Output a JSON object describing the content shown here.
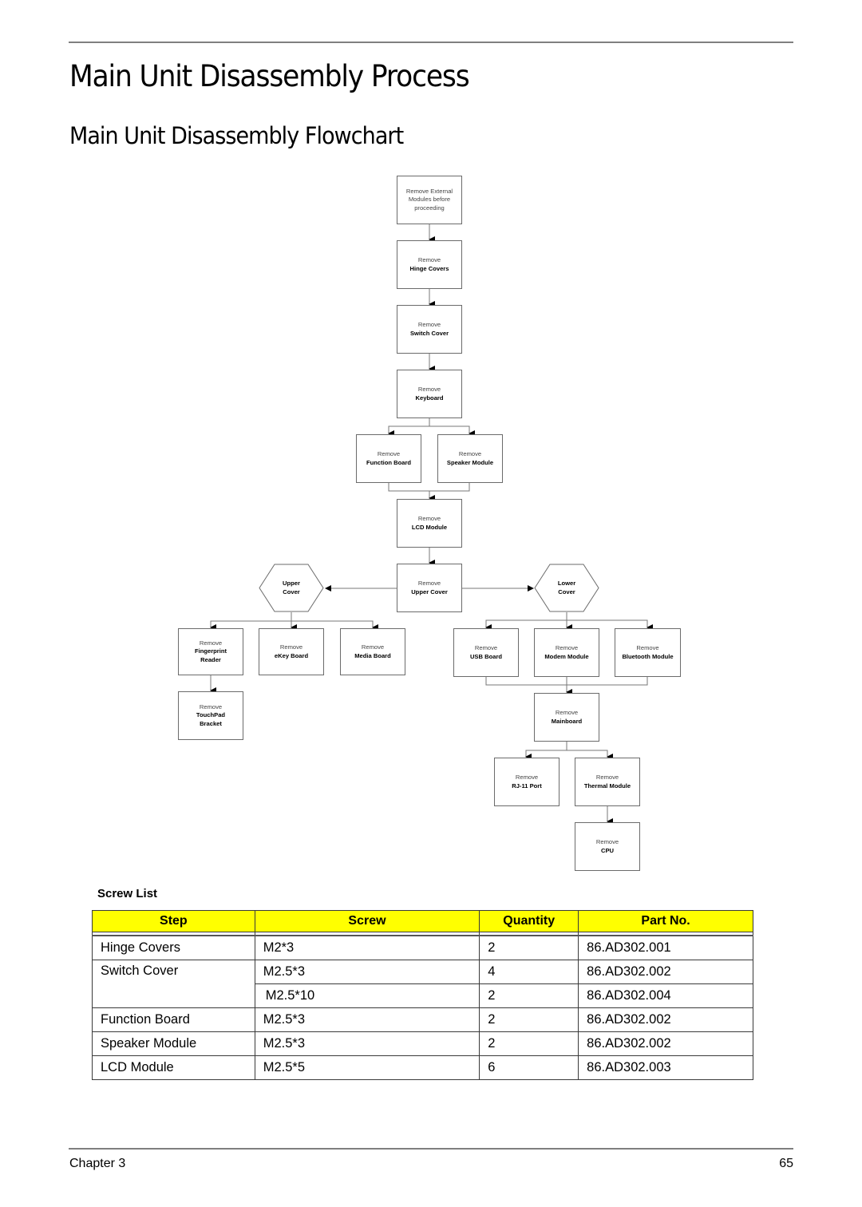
{
  "page": {
    "title": "Main Unit Disassembly Process",
    "subtitle": "Main Unit Disassembly Flowchart",
    "footer_left": "Chapter 3",
    "footer_right": "65"
  },
  "flowchart": {
    "start": {
      "l1": "Remove External",
      "l2": "Modules before",
      "l3": "proceeding"
    },
    "hinge": {
      "l1": "Remove",
      "l2": "Hinge Covers"
    },
    "switch": {
      "l1": "Remove",
      "l2": "Switch Cover"
    },
    "keyboard": {
      "l1": "Remove",
      "l2": "Keyboard"
    },
    "function": {
      "l1": "Remove",
      "l2": "Function Board"
    },
    "speaker": {
      "l1": "Remove",
      "l2": "Speaker Module"
    },
    "lcd": {
      "l1": "Remove",
      "l2": "LCD Module"
    },
    "uppercover": {
      "l1": "Remove",
      "l2": "Upper Cover"
    },
    "upper_hex": {
      "l1": "Upper",
      "l2": "Cover"
    },
    "lower_hex": {
      "l1": "Lower",
      "l2": "Cover"
    },
    "fingerprint": {
      "l1": "Remove",
      "l2": "Fingerprint",
      "l3": "Reader"
    },
    "ekey": {
      "l1": "Remove",
      "l2": "eKey Board"
    },
    "media": {
      "l1": "Remove",
      "l2": "Media Board"
    },
    "touchpad": {
      "l1": "Remove",
      "l2": "TouchPad",
      "l3": "Bracket"
    },
    "usb": {
      "l1": "Remove",
      "l2": "USB Board"
    },
    "modem": {
      "l1": "Remove",
      "l2": "Modem Module"
    },
    "bluetooth": {
      "l1": "Remove",
      "l2": "Bluetooth Module"
    },
    "mainboard": {
      "l1": "Remove",
      "l2": "Mainboard"
    },
    "rj11": {
      "l1": "Remove",
      "l2": "RJ-11 Port"
    },
    "thermal": {
      "l1": "Remove",
      "l2": "Thermal Module"
    },
    "cpu": {
      "l1": "Remove",
      "l2": "CPU"
    }
  },
  "screw_list": {
    "title": "Screw List",
    "headers": [
      "Step",
      "Screw",
      "Quantity",
      "Part No."
    ],
    "rows": [
      {
        "step": "Hinge Covers",
        "screw": "M2*3",
        "qty": "2",
        "part": "86.AD302.001"
      },
      {
        "step": "Switch Cover",
        "screw": "M2.5*3",
        "qty": "4",
        "part": "86.AD302.002"
      },
      {
        "step": "",
        "screw": "M2.5*10",
        "qty": "2",
        "part": "86.AD302.004"
      },
      {
        "step": "Function Board",
        "screw": "M2.5*3",
        "qty": "2",
        "part": "86.AD302.002"
      },
      {
        "step": "Speaker Module",
        "screw": "M2.5*3",
        "qty": "2",
        "part": "86.AD302.002"
      },
      {
        "step": "LCD Module",
        "screw": "M2.5*5",
        "qty": "6",
        "part": "86.AD302.003"
      }
    ]
  }
}
